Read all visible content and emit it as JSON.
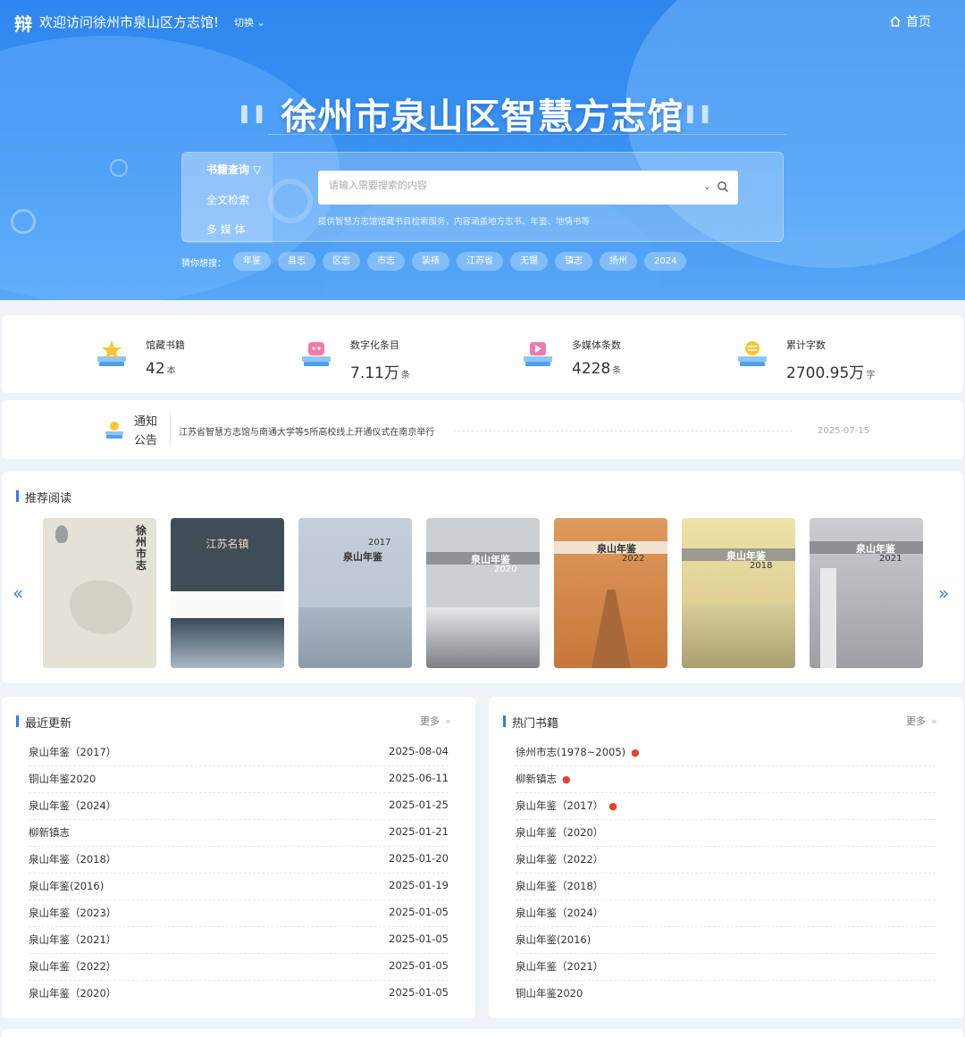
{
  "header": {
    "logo_glyph": "辩",
    "welcome": "欢迎访问徐州市泉山区方志馆!",
    "switch_label": "切换",
    "home_label": "首页"
  },
  "hero": {
    "title": "徐州市泉山区智慧方志馆",
    "search_tabs": [
      "书籍查询",
      "全文检索",
      "多 媒 体"
    ],
    "search_placeholder": "请输入需要搜索的内容",
    "search_desc": "提供智慧方志馆馆藏书目检索服务，内容涵盖地方志书、年鉴、地情书等",
    "guess_label": "猜你想搜：",
    "guess_tags": [
      "年鉴",
      "县志",
      "区志",
      "市志",
      "装裱",
      "江苏省",
      "无锡",
      "镇志",
      "扬州",
      "2024"
    ]
  },
  "stats": [
    {
      "label": "馆藏书籍",
      "value": "42",
      "unit": "本",
      "icon": "book-star-icon"
    },
    {
      "label": "数字化条目",
      "value": "7.11万",
      "unit": "条",
      "icon": "book-digital-icon"
    },
    {
      "label": "多媒体条数",
      "value": "4228",
      "unit": "条",
      "icon": "book-play-icon"
    },
    {
      "label": "累计字数",
      "value": "2700.95万",
      "unit": "字",
      "icon": "book-text-icon"
    }
  ],
  "notice": {
    "label_line1": "通知",
    "label_line2": "公告",
    "text": "江苏省智慧方志馆与南通大学等5所高校线上开通仪式在南京举行",
    "date": "2025-07-15"
  },
  "recommend": {
    "title": "推荐阅读",
    "prev": "«",
    "next": "»",
    "books": [
      {
        "title": "徐州市志",
        "year": "",
        "color": "#e4e1d6"
      },
      {
        "title": "江苏名镇",
        "year": "",
        "color": "#3f4d56"
      },
      {
        "title": "泉山年鉴",
        "year": "2017",
        "color": "#bfc9d6"
      },
      {
        "title": "泉山年鉴",
        "year": "2020",
        "color": "#c9ccd0"
      },
      {
        "title": "泉山年鉴",
        "year": "2022",
        "color": "#d88d4f"
      },
      {
        "title": "泉山年鉴",
        "year": "2018",
        "color": "#e6d79b"
      },
      {
        "title": "泉山年鉴",
        "year": "2021",
        "color": "#c4c4c8"
      }
    ]
  },
  "recent": {
    "title": "最近更新",
    "more": "更多",
    "more_glyph": "»",
    "items": [
      {
        "title": "泉山年鉴（2017）",
        "date": "2025-08-04"
      },
      {
        "title": "铜山年鉴2020",
        "date": "2025-06-11"
      },
      {
        "title": "泉山年鉴（2024）",
        "date": "2025-01-25"
      },
      {
        "title": "柳新镇志",
        "date": "2025-01-21"
      },
      {
        "title": "泉山年鉴（2018）",
        "date": "2025-01-20"
      },
      {
        "title": "泉山年鉴(2016)",
        "date": "2025-01-19"
      },
      {
        "title": "泉山年鉴（2023）",
        "date": "2025-01-05"
      },
      {
        "title": "泉山年鉴（2021）",
        "date": "2025-01-05"
      },
      {
        "title": "泉山年鉴（2022）",
        "date": "2025-01-05"
      },
      {
        "title": "泉山年鉴（2020）",
        "date": "2025-01-05"
      }
    ]
  },
  "hot": {
    "title": "热门书籍",
    "more": "更多",
    "more_glyph": "»",
    "items": [
      {
        "title": "徐州市志(1978~2005)",
        "hot": true
      },
      {
        "title": "柳新镇志",
        "hot": true
      },
      {
        "title": "泉山年鉴（2017）",
        "hot": true
      },
      {
        "title": "泉山年鉴（2020）",
        "hot": false
      },
      {
        "title": "泉山年鉴（2022）",
        "hot": false
      },
      {
        "title": "泉山年鉴（2018）",
        "hot": false
      },
      {
        "title": "泉山年鉴（2024）",
        "hot": false
      },
      {
        "title": "泉山年鉴(2016)",
        "hot": false
      },
      {
        "title": "泉山年鉴（2021）",
        "hot": false
      },
      {
        "title": "铜山年鉴2020",
        "hot": false
      }
    ]
  },
  "colors": {
    "accent": "#2f7de9",
    "hero_blue": "#3c93f3",
    "fire": "#e4432e"
  }
}
